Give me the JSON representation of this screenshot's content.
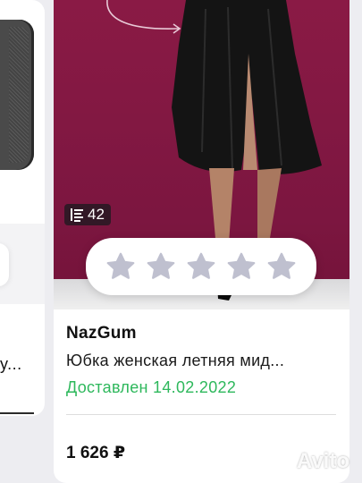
{
  "left_card": {
    "text_fragment": "y..."
  },
  "product": {
    "photo_count": "42",
    "seller": "NazGum",
    "title": "Юбка женская летняя мид...",
    "status": "Доставлен 14.02.2022",
    "price": "1 626 ₽"
  },
  "rating": {
    "value": 0,
    "max": 5
  },
  "watermark": {
    "text": "Avito"
  },
  "colors": {
    "status_green": "#2eb85c",
    "star_inactive": "#bfc0cf",
    "photo_background": "#7c1640"
  }
}
